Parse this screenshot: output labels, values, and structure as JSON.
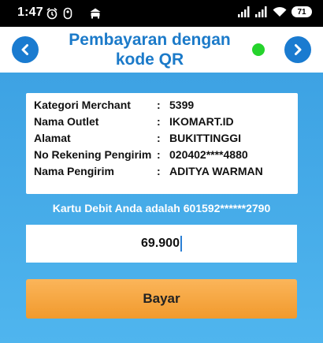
{
  "status_bar": {
    "time": "1:47",
    "battery": "71",
    "icons": [
      "alarm-icon",
      "notification-icon",
      "car-icon",
      "signal-icon",
      "signal-icon",
      "wifi-icon",
      "battery-icon"
    ]
  },
  "header": {
    "title": "Pembayaran dengan kode QR",
    "back_icon": "chevron-left-icon",
    "next_icon": "chevron-right-icon",
    "status_color": "#25d32c"
  },
  "info": [
    {
      "label": "Kategori Merchant",
      "sep": ":",
      "value": "5399"
    },
    {
      "label": "Nama Outlet",
      "sep": ":",
      "value": "IKOMART.ID"
    },
    {
      "label": "Alamat",
      "sep": ":",
      "value": "BUKITTINGGI"
    },
    {
      "label": "No Rekening Pengirim",
      "sep": ":",
      "value": "020402****4880"
    },
    {
      "label": "Nama Pengirim",
      "sep": ":",
      "value": "ADITYA WARMAN"
    }
  ],
  "debit_text": "Kartu Debit Anda adalah 601592******2790",
  "amount": "69.900",
  "pay_label": "Bayar",
  "colors": {
    "primary": "#1b7ac9",
    "background": "#3ea6e6",
    "button": "#f4a23b"
  }
}
